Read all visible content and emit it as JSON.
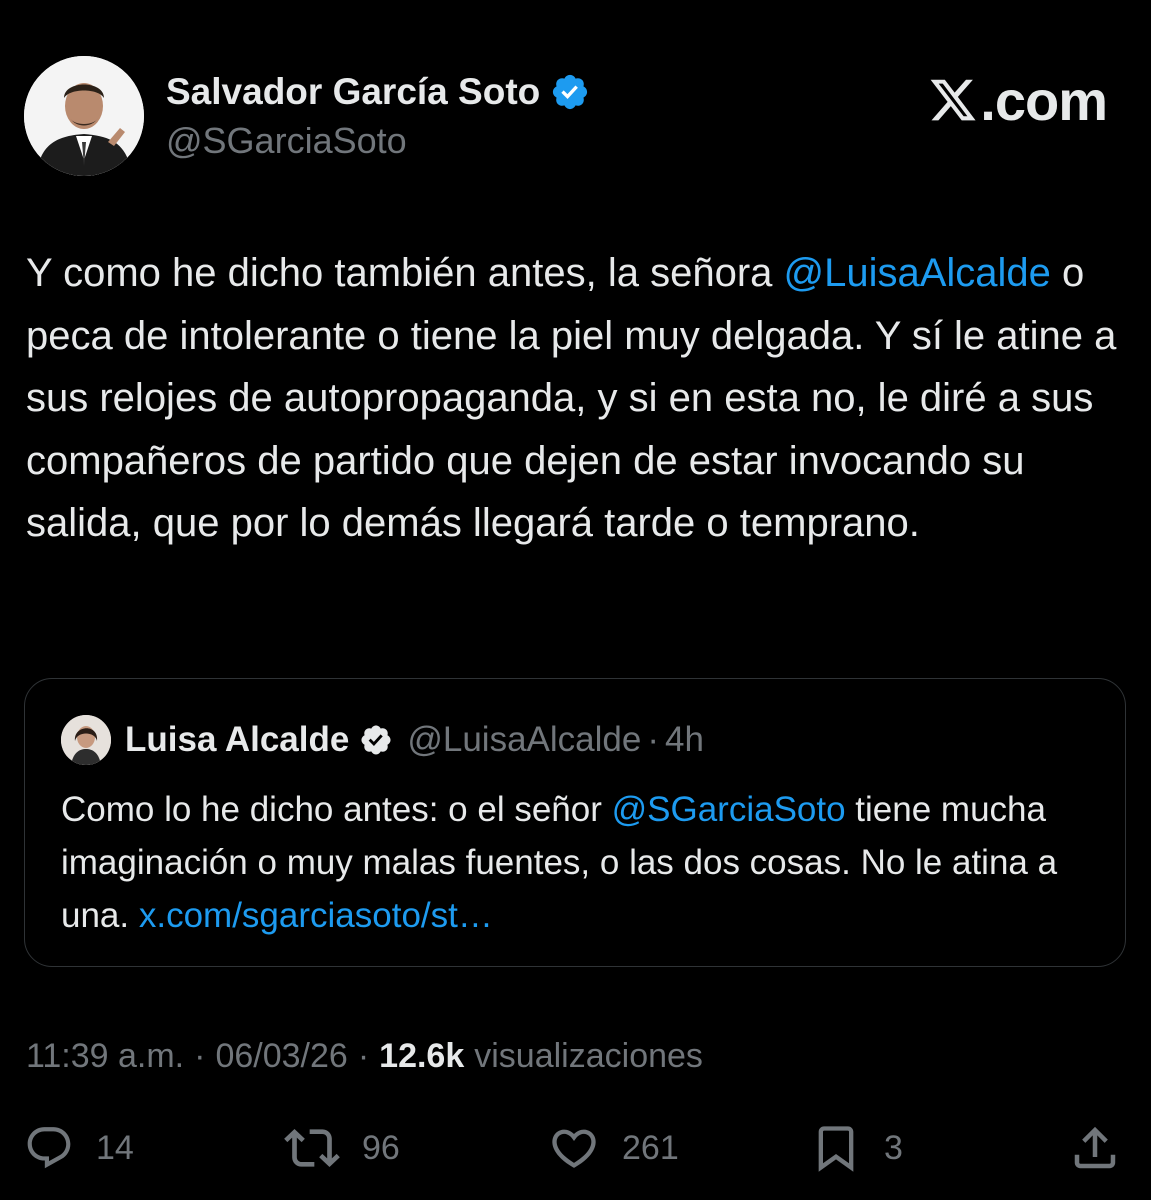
{
  "author": {
    "name": "Salvador García Soto",
    "handle": "@SGarciaSoto",
    "verified": true
  },
  "brand": {
    "icon": "x-logo-icon",
    "domain": ".com"
  },
  "tweet": {
    "text_before_mention": "Y como he dicho también antes, la señora ",
    "mention": "@LuisaAlcalde",
    "text_after_mention": " o peca de intolerante o tiene la piel muy delgada. Y sí le atine a sus relojes de autopropaganda, y si en esta no, le diré a sus compañeros de partido que dejen de estar invocando su salida, que por lo demás llegará tarde o temprano."
  },
  "quote": {
    "name": "Luisa Alcalde",
    "handle": "@LuisaAlcalde",
    "separator": "·",
    "time": "4h",
    "text_before_mention": "Como lo he dicho antes: o el señor ",
    "mention": "@SGarciaSoto",
    "text_after_mention": " tiene mucha imaginación o muy malas fuentes, o las dos cosas. No le atina a una. ",
    "link": "x.com/sgarciasoto/st…"
  },
  "meta": {
    "time": "11:39 a.m.",
    "separator": "·",
    "date": "06/03/26",
    "views_count": "12.6k",
    "views_label": "visualizaciones"
  },
  "actions": {
    "replies": "14",
    "reposts": "96",
    "likes": "261",
    "bookmarks": "3"
  },
  "colors": {
    "background": "#000000",
    "text": "#e7e9ea",
    "secondary": "#71767b",
    "accent": "#1d9bf0",
    "border": "#2f3336"
  }
}
